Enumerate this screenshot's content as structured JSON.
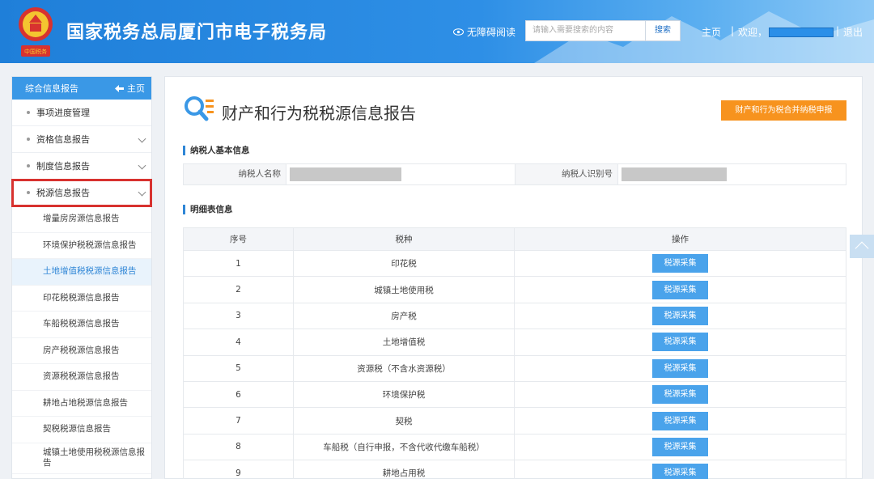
{
  "header": {
    "site_title": "国家税务总局厦门市电子税务局",
    "accessibility_label": "无障碍阅读",
    "search_placeholder": "请输入需要搜索的内容",
    "search_button": "搜索",
    "nav_home": "主页",
    "nav_separator": "|",
    "nav_welcome": "欢迎，",
    "nav_logout": "退出",
    "logo_text": "中国税务"
  },
  "sidebar": {
    "header_title": "综合信息报告",
    "header_home": "主页",
    "items": [
      {
        "label": "事项进度管理",
        "expandable": false
      },
      {
        "label": "资格信息报告",
        "expandable": true
      },
      {
        "label": "制度信息报告",
        "expandable": true
      },
      {
        "label": "税源信息报告",
        "expandable": true,
        "highlighted": true
      }
    ],
    "sub_items": [
      {
        "label": "增量房房源信息报告"
      },
      {
        "label": "环境保护税税源信息报告"
      },
      {
        "label": "土地增值税税源信息报告",
        "active": true
      },
      {
        "label": "印花税税源信息报告"
      },
      {
        "label": "车船税税源信息报告"
      },
      {
        "label": "房产税税源信息报告"
      },
      {
        "label": "资源税税源信息报告"
      },
      {
        "label": "耕地占地税源信息报告"
      },
      {
        "label": "契税税源信息报告"
      },
      {
        "label": "城镇土地使用税税源信息报告"
      }
    ]
  },
  "main": {
    "page_title": "财产和行为税税源信息报告",
    "merge_button": "财产和行为税合并纳税申报",
    "basic_info_title": "纳税人基本信息",
    "taxpayer_name_label": "纳税人名称",
    "taxpayer_id_label": "纳税人识别号",
    "detail_title": "明细表信息",
    "table": {
      "headers": [
        "序号",
        "税种",
        "操作"
      ],
      "action_label": "税源采集",
      "rows": [
        {
          "no": "1",
          "tax": "印花税"
        },
        {
          "no": "2",
          "tax": "城镇土地使用税"
        },
        {
          "no": "3",
          "tax": "房产税"
        },
        {
          "no": "4",
          "tax": "土地增值税"
        },
        {
          "no": "5",
          "tax": "资源税（不含水资源税）"
        },
        {
          "no": "6",
          "tax": "环境保护税"
        },
        {
          "no": "7",
          "tax": "契税"
        },
        {
          "no": "8",
          "tax": "车船税（自行申报，不含代收代缴车船税）"
        },
        {
          "no": "9",
          "tax": "耕地占用税"
        }
      ]
    }
  },
  "colors": {
    "header_blue": "#1f7fd9",
    "accent_blue": "#3a98e6",
    "button_orange": "#f7931e",
    "highlight_red": "#d8322f"
  },
  "icons": {
    "logo": "tax-emblem-icon",
    "accessibility": "eye-icon",
    "home": "back-arrow-icon",
    "page": "magnifier-list-icon",
    "scroll_top": "chevron-up-icon"
  }
}
